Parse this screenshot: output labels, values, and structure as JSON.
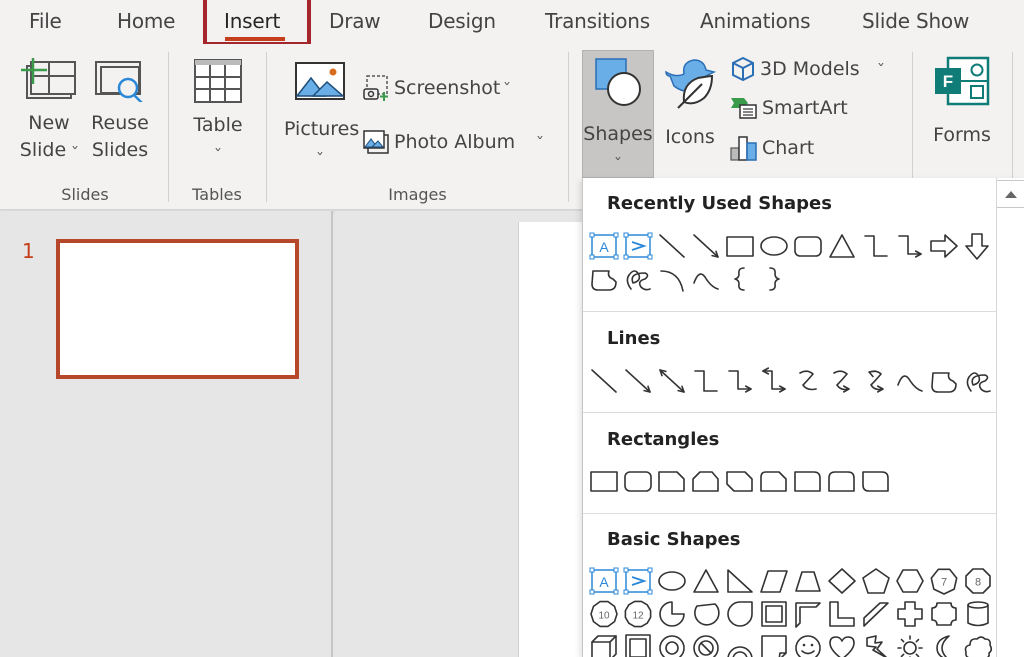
{
  "tabs": [
    {
      "label": "File"
    },
    {
      "label": "Home"
    },
    {
      "label": "Insert",
      "active": true
    },
    {
      "label": "Draw"
    },
    {
      "label": "Design"
    },
    {
      "label": "Transitions"
    },
    {
      "label": "Animations"
    },
    {
      "label": "Slide Show"
    }
  ],
  "ribbon": {
    "groups": {
      "slides": "Slides",
      "tables": "Tables",
      "images": "Images"
    },
    "new_slide": {
      "line1": "New",
      "line2": "Slide"
    },
    "reuse_slides": {
      "line1": "Reuse",
      "line2": "Slides"
    },
    "table": "Table",
    "pictures": "Pictures",
    "screenshot": "Screenshot",
    "photo_album": "Photo Album",
    "shapes": "Shapes",
    "icons": "Icons",
    "models_3d": "3D Models",
    "smartart": "SmartArt",
    "chart": "Chart",
    "forms": "Forms"
  },
  "thumbnails": {
    "slide_number": "1"
  },
  "shapes_menu": {
    "sections": [
      {
        "title": "Recently Used Shapes"
      },
      {
        "title": "Lines"
      },
      {
        "title": "Rectangles"
      },
      {
        "title": "Basic Shapes"
      }
    ],
    "recent": [
      "text-box",
      "vertical-text-box",
      "line",
      "line-arrow",
      "rectangle",
      "oval",
      "rounded-rectangle",
      "triangle",
      "elbow-connector",
      "elbow-arrow-connector",
      "right-arrow",
      "down-arrow",
      "freeform-shape",
      "scribble",
      "arc",
      "curve",
      "left-brace",
      "right-brace"
    ],
    "lines": [
      "line",
      "line-arrow",
      "line-double-arrow",
      "elbow-connector",
      "elbow-arrow-connector",
      "elbow-double-arrow-connector",
      "curved-connector",
      "curved-arrow-connector",
      "curved-double-arrow-connector",
      "curve",
      "freeform-shape",
      "scribble"
    ],
    "rectangles": [
      "rectangle",
      "rounded-rectangle",
      "single-corner-snipped",
      "same-side-corner-snipped",
      "diagonal-corner-snipped",
      "snip-round-single-corner",
      "single-corner-rounded",
      "same-side-corner-rounded",
      "diagonal-corner-rounded"
    ],
    "basic_labels": {
      "heptagon": "7",
      "octagon": "8",
      "decagon": "10",
      "dodecagon": "12"
    }
  },
  "colors": {
    "accent": "#c43e1c",
    "tab_highlight": "#a4262c",
    "icon_blue": "#2b88d8",
    "forms_teal": "#107c78"
  }
}
